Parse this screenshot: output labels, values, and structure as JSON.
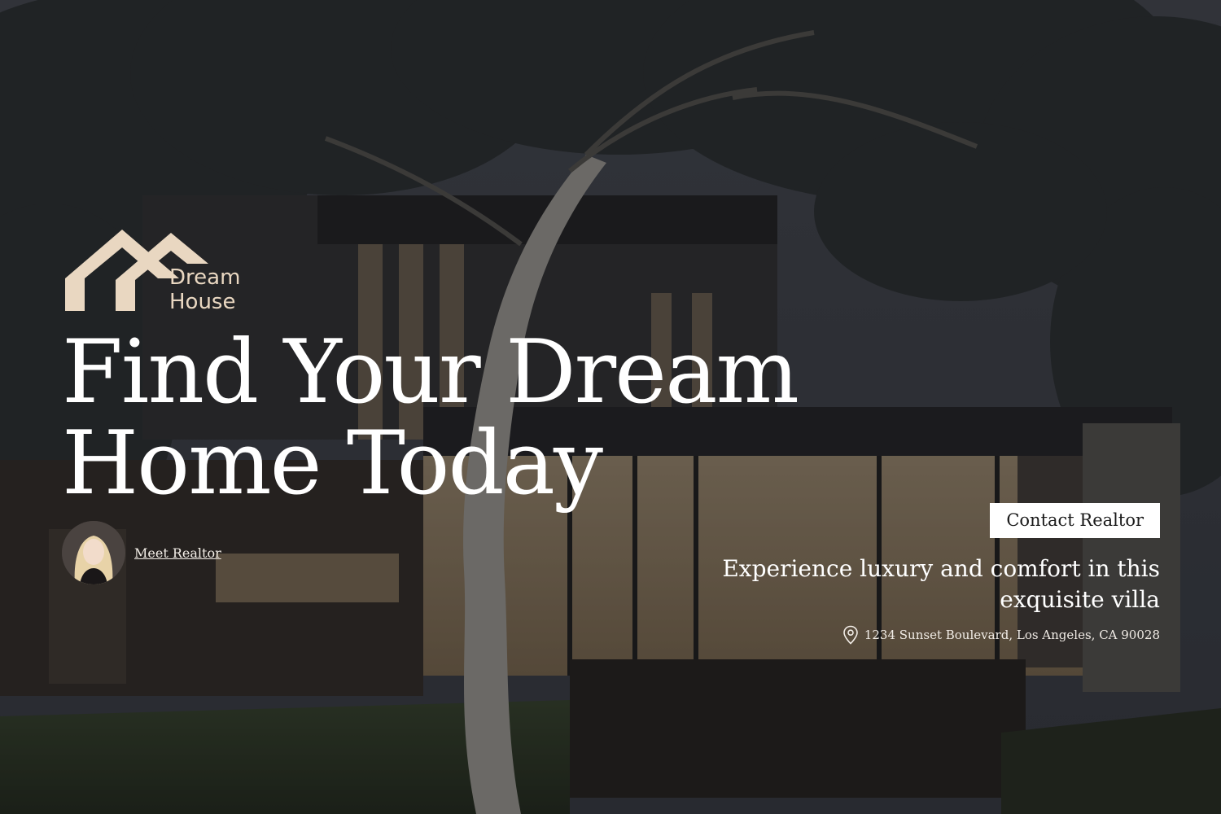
{
  "brand": {
    "logo_line1": "Dream",
    "logo_line2": "House",
    "logo_icon": "house-roof-icon",
    "accent_color": "#e9d7c1"
  },
  "hero": {
    "headline_line1": "Find Your Dream",
    "headline_line2": "Home Today",
    "background_image": "modern-villa-at-dusk"
  },
  "realtor": {
    "meet_label": "Meet Realtor",
    "avatar_icon": "realtor-avatar"
  },
  "cta": {
    "contact_label": "Contact Realtor"
  },
  "property": {
    "tagline": "Experience luxury and comfort in this exquisite villa",
    "address": "1234 Sunset Boulevard, Los Angeles, CA 90028",
    "address_icon": "location-pin-icon"
  }
}
